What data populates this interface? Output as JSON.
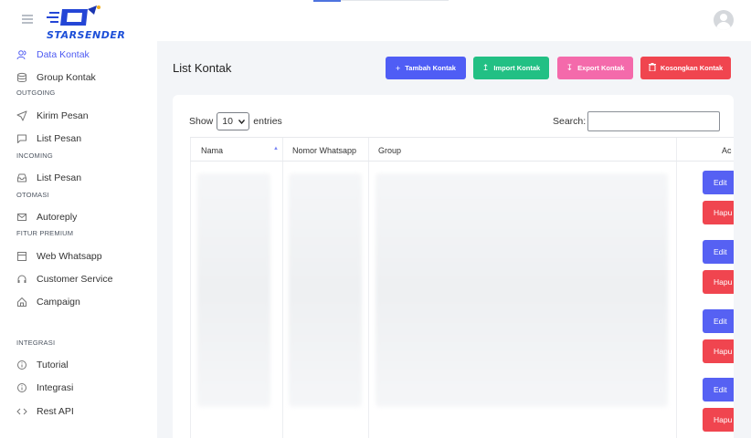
{
  "brand": {
    "logo_text": "STARSENDER"
  },
  "sidebar": {
    "items": [
      {
        "label": "Data Kontak",
        "icon": "user-group-icon"
      },
      {
        "label": "Group Kontak",
        "icon": "database-icon"
      },
      {
        "section": "OUTGOING"
      },
      {
        "label": "Kirim Pesan",
        "icon": "send-icon"
      },
      {
        "label": "List Pesan",
        "icon": "message-icon"
      },
      {
        "section": "INCOMING"
      },
      {
        "label": "List Pesan",
        "icon": "inbox-icon"
      },
      {
        "section": "OTOMASI"
      },
      {
        "label": "Autoreply",
        "icon": "mail-icon"
      },
      {
        "section": "FITUR PREMIUM"
      },
      {
        "label": "Web Whatsapp",
        "icon": "window-icon"
      },
      {
        "label": "Customer Service",
        "icon": "headset-icon"
      },
      {
        "label": "Campaign",
        "icon": "home-icon"
      },
      {
        "section": "INTEGRASI"
      },
      {
        "label": "Tutorial",
        "icon": "info-icon"
      },
      {
        "label": "Integrasi",
        "icon": "info-icon"
      },
      {
        "label": "Rest API",
        "icon": "code-icon"
      }
    ]
  },
  "main": {
    "title": "List Kontak",
    "buttons": {
      "tambah": "Tambah Kontak",
      "import": "Import Kontak",
      "export": "Export Kontak",
      "kosongkan": "Kosongkan Kontak"
    },
    "table": {
      "show_label": "Show",
      "entries_value": "10",
      "entries_label": "entries",
      "search_label": "Search:",
      "search_value": "",
      "columns": [
        "Nama",
        "Nomor Whatsapp",
        "Group",
        "Ac"
      ],
      "row_actions": {
        "edit": "Edit",
        "delete": "Hapu"
      }
    }
  },
  "colors": {
    "primary": "#4f5df5",
    "success": "#22c084",
    "pink": "#f46aab",
    "danger": "#f0454f",
    "active_nav": "#4e5bf2"
  }
}
